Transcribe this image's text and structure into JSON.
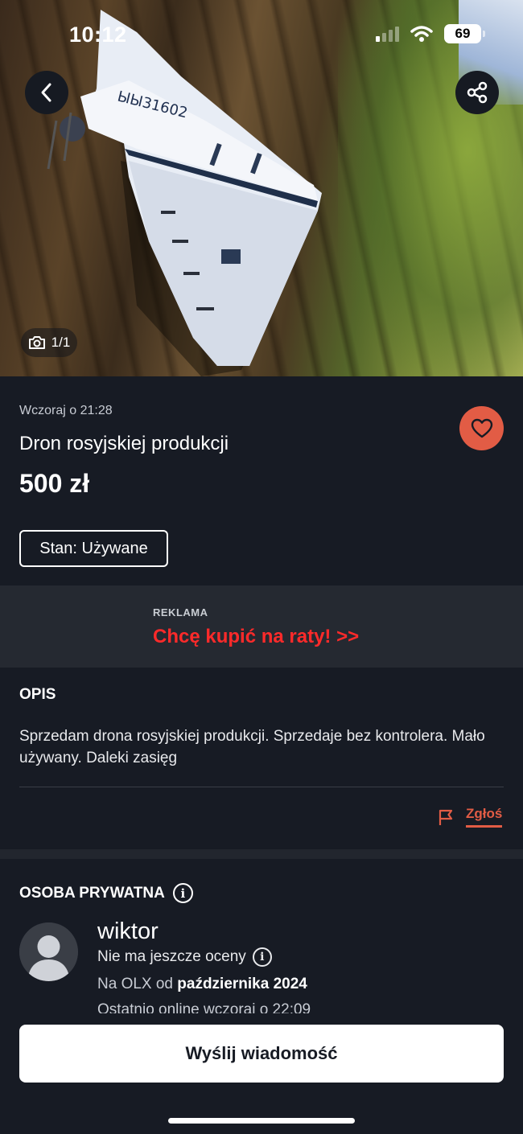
{
  "status_bar": {
    "time": "10:12",
    "battery": "69"
  },
  "hero": {
    "photo_counter": "1/1",
    "drone_marking": "ЫЫ31602"
  },
  "listing": {
    "posted": "Wczoraj o 21:28",
    "title": "Dron rosyjskiej produkcji",
    "price": "500 zł",
    "condition": "Stan: Używane"
  },
  "ad": {
    "label": "REKLAMA",
    "link": "Chcę kupić na raty! >>"
  },
  "description": {
    "heading": "OPIS",
    "text": "Sprzedam drona rosyjskiej produkcji. Sprzedaje bez kontrolera. Mało używany. Daleki zasięg",
    "report_label": "Zgłoś"
  },
  "seller": {
    "type": "OSOBA PRYWATNA",
    "name": "wiktor",
    "rating": "Nie ma jeszcze oceny",
    "member_prefix": "Na OLX od",
    "member_since": "października 2024",
    "last_online": "Ostatnio online wczoraj o 22:09"
  },
  "actions": {
    "send_message": "Wyślij wiadomość"
  },
  "colors": {
    "accent": "#e25c45",
    "ad_link": "#ff2a2a",
    "background": "#171b24"
  }
}
